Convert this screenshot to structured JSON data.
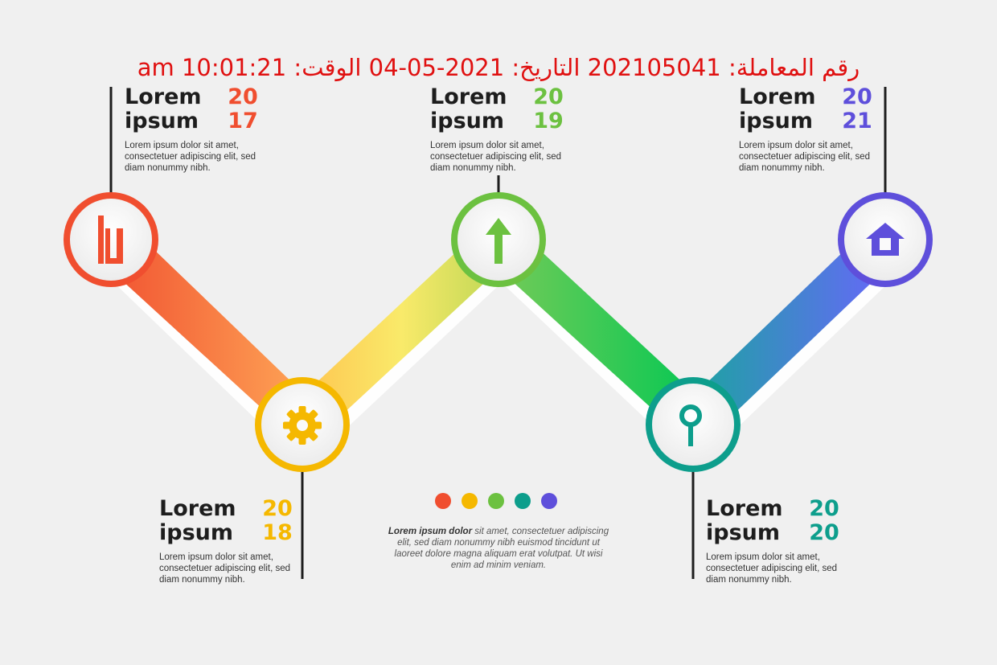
{
  "header": {
    "text": "رقم المعاملة: 202105041 التاريخ: 2021-05-04 الوقت: 10:01:21 am"
  },
  "steps": [
    {
      "word1": "Lorem",
      "word2": "ipsum",
      "year_top": "20",
      "year_bottom": "17",
      "color": "#f04e2f",
      "icon": "bar-chart-icon",
      "body": "Lorem ipsum dolor sit amet, consectetuer adipiscing elit, sed diam nonummy nibh."
    },
    {
      "word1": "Lorem",
      "word2": "ipsum",
      "year_top": "20",
      "year_bottom": "18",
      "color": "#f5b800",
      "icon": "gear-icon",
      "body": "Lorem ipsum dolor sit amet, consectetuer adipiscing elit, sed diam nonummy nibh."
    },
    {
      "word1": "Lorem",
      "word2": "ipsum",
      "year_top": "20",
      "year_bottom": "19",
      "color": "#6cc140",
      "icon": "arrow-up-icon",
      "body": "Lorem ipsum dolor sit amet, consectetuer adipiscing elit, sed diam nonummy nibh."
    },
    {
      "word1": "Lorem",
      "word2": "ipsum",
      "year_top": "20",
      "year_bottom": "20",
      "color": "#0d9e8c",
      "icon": "search-icon",
      "body": "Lorem ipsum dolor sit amet, consectetuer adipiscing elit, sed diam nonummy nibh."
    },
    {
      "word1": "Lorem",
      "word2": "ipsum",
      "year_top": "20",
      "year_bottom": "21",
      "color": "#5e4fdb",
      "icon": "home-icon",
      "body": "Lorem ipsum dolor sit amet, consectetuer adipiscing elit, sed diam nonummy nibh."
    }
  ],
  "center": {
    "lead": "Lorem ipsum dolor",
    "rest": " sit amet, consectetuer adipiscing elit, sed diam nonummy nibh euismod tincidunt ut laoreet dolore magna aliquam erat volutpat. Ut wisi enim ad minim veniam.",
    "dot_colors": [
      "#f04e2f",
      "#f5b800",
      "#6cc140",
      "#0d9e8c",
      "#5e4fdb"
    ]
  },
  "band_colors": {
    "band1": [
      "#f04e2f",
      "#ffa958"
    ],
    "band2": [
      "#ffc04d",
      "#f9ea6a",
      "#b6d452"
    ],
    "band3": [
      "#7ccb58",
      "#00c853"
    ],
    "band4": [
      "#18a79c",
      "#6c63ff"
    ]
  }
}
